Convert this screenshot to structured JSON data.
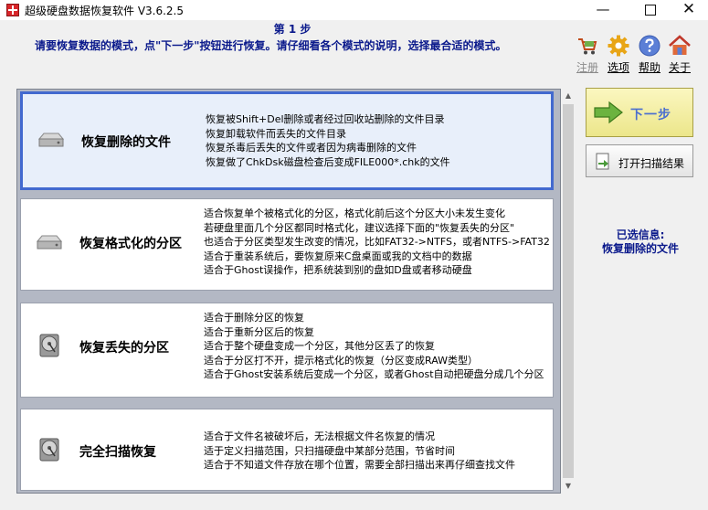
{
  "window": {
    "title": "超级硬盘数据恢复软件 V3.6.2.5",
    "minimize_glyph": "—",
    "close_glyph": "✕"
  },
  "header": {
    "step_title": "第 1 步",
    "instruction": "请要恢复数据的模式，点\"下一步\"按钮进行恢复。请仔细看各个模式的说明，选择最合适的模式。"
  },
  "toolbar": {
    "items": [
      {
        "label": "注册",
        "icon": "cart-icon",
        "enabled": false
      },
      {
        "label": "选项",
        "icon": "gear-icon",
        "enabled": true
      },
      {
        "label": "帮助",
        "icon": "help-icon",
        "enabled": true
      },
      {
        "label": "关于",
        "icon": "home-icon",
        "enabled": true
      }
    ]
  },
  "options": [
    {
      "name": "恢复删除的文件",
      "icon": "hard-disk-icon",
      "selected": true,
      "desc": [
        "恢复被Shift+Del删除或者经过回收站删除的文件目录",
        "恢复卸载软件而丢失的文件目录",
        "恢复杀毒后丢失的文件或者因为病毒删除的文件",
        "恢复做了ChkDsk磁盘检查后变成FILE000*.chk的文件"
      ]
    },
    {
      "name": "恢复格式化的分区",
      "icon": "hard-disk-icon",
      "selected": false,
      "desc": [
        "适合恢复单个被格式化的分区，格式化前后这个分区大小未发生变化",
        "若硬盘里面几个分区都同时格式化，建议选择下面的\"恢复丢失的分区\"",
        "也适合于分区类型发生改变的情况，比如FAT32->NTFS，或者NTFS->FAT32",
        "适合于重装系统后，要恢复原来C盘桌面或我的文档中的数据",
        "适合于Ghost误操作，把系统装到别的盘如D盘或者移动硬盘"
      ]
    },
    {
      "name": "恢复丢失的分区",
      "icon": "disk-platter-icon",
      "selected": false,
      "desc": [
        "适合于删除分区的恢复",
        "适合于重新分区后的恢复",
        "适合于整个硬盘变成一个分区，其他分区丢了的恢复",
        "适合于分区打不开，提示格式化的恢复（分区变成RAW类型）",
        "适合于Ghost安装系统后变成一个分区，或者Ghost自动把硬盘分成几个分区"
      ]
    },
    {
      "name": "完全扫描恢复",
      "icon": "disk-platter-icon",
      "selected": false,
      "desc": [
        "适合于文件名被破坏后，无法根据文件名恢复的情况",
        "适于定义扫描范围，只扫描硬盘中某部分范围，节省时间",
        "适合于不知道文件存放在哪个位置，需要全部扫描出来再仔细查找文件"
      ]
    }
  ],
  "scrollbar": {
    "up_glyph": "▲",
    "down_glyph": "▼"
  },
  "buttons": {
    "next": "下一步",
    "open_scan": "打开扫描结果"
  },
  "selection": {
    "label": "已选信息:",
    "value": "恢复删除的文件"
  }
}
